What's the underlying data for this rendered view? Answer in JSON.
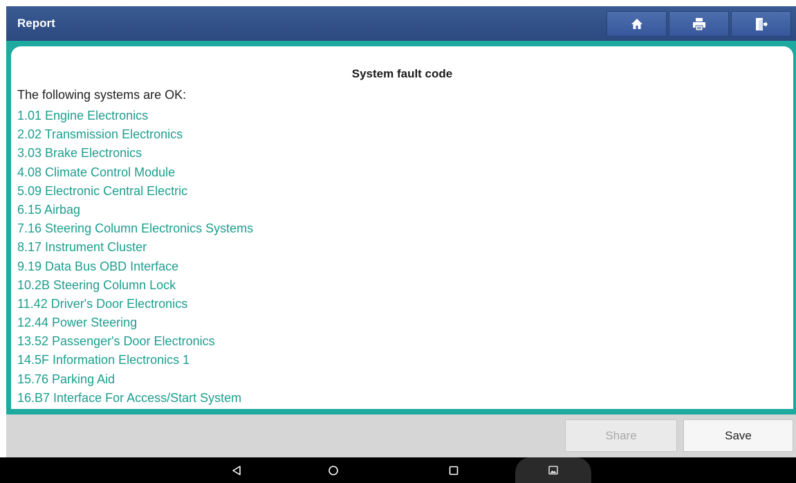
{
  "header": {
    "title": "Report",
    "buttons": [
      {
        "icon": "home-icon"
      },
      {
        "icon": "printer-icon"
      },
      {
        "icon": "exit-icon"
      }
    ]
  },
  "report": {
    "heading": "System fault code",
    "intro": "The following systems are OK:",
    "systems": [
      "1.01 Engine Electronics",
      "2.02 Transmission Electronics",
      "3.03 Brake Electronics",
      "4.08 Climate Control Module",
      "5.09 Electronic Central Electric",
      "6.15 Airbag",
      "7.16 Steering Column Electronics Systems",
      "8.17 Instrument Cluster",
      "9.19 Data Bus OBD Interface",
      "10.2B Steering Column Lock",
      "11.42 Driver's Door Electronics",
      "12.44 Power Steering",
      "13.52 Passenger's Door Electronics",
      "14.5F Information Electronics 1",
      "15.76 Parking Aid",
      "16.B7 Interface For Access/Start System"
    ]
  },
  "actions": {
    "share_label": "Share",
    "save_label": "Save"
  },
  "navbar": {
    "icons": [
      "back-icon",
      "home-circle-icon",
      "recents-icon",
      "screenshot-icon"
    ]
  },
  "colors": {
    "header": "#2f4f88",
    "frame": "#1faaa0",
    "list_text": "#1c9e8e",
    "action_bar": "#d6d6d6"
  }
}
